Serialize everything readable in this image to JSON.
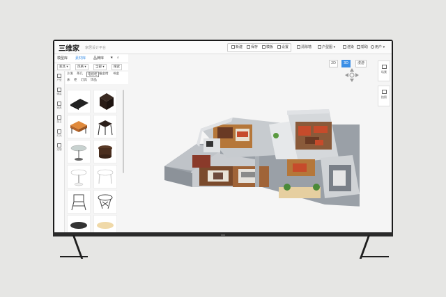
{
  "app": {
    "logo_text": "三维家",
    "subtitle": "家居设计平台"
  },
  "toolbar": {
    "buttons": [
      {
        "label": "新建",
        "icon": "file-icon"
      },
      {
        "label": "保存",
        "icon": "save-icon"
      },
      {
        "label": "模板",
        "icon": "template-icon"
      },
      {
        "label": "设置",
        "icon": "gear-icon"
      },
      {
        "label": "清除墙",
        "icon": "wall-icon"
      },
      {
        "label": "户型图",
        "icon": "floorplan-icon"
      },
      {
        "label": "渲染",
        "icon": "render-icon"
      },
      {
        "label": "帮助",
        "icon": "help-icon"
      },
      {
        "label": "用户",
        "icon": "user-icon"
      }
    ]
  },
  "panel_tabs": [
    {
      "label": "模型库",
      "active": false
    },
    {
      "label": "素材库",
      "active": true
    },
    {
      "label": "品牌库",
      "active": false
    }
  ],
  "filters": {
    "category_select": "家具",
    "style_select": "风格",
    "all_select": "全部",
    "search_placeholder": "搜索"
  },
  "categories": [
    {
      "label": "沙发"
    },
    {
      "label": "茶几"
    },
    {
      "label": "电视柜",
      "boxed": true
    },
    {
      "label": "餐桌椅"
    },
    {
      "label": "书桌"
    },
    {
      "label": "床"
    },
    {
      "label": "柜"
    },
    {
      "label": "灯具"
    },
    {
      "label": "饰品"
    }
  ],
  "side_nav": [
    {
      "label": "户型",
      "icon": "floorplan-icon"
    },
    {
      "label": "硬装",
      "icon": "wall-icon"
    },
    {
      "label": "家具",
      "icon": "furniture-icon"
    },
    {
      "label": "厨卫",
      "icon": "kitchen-icon"
    },
    {
      "label": "灯光",
      "icon": "light-icon"
    },
    {
      "label": "定制",
      "icon": "grid-icon"
    }
  ],
  "view_toggles": [
    {
      "label": "2D",
      "active": false
    },
    {
      "label": "3D",
      "active": true
    },
    {
      "label": "漫游",
      "active": false
    }
  ],
  "right_panel": [
    {
      "label": "场景",
      "icon": "home-icon"
    },
    {
      "label": "拍照",
      "icon": "camera-icon"
    }
  ],
  "colors": {
    "accent": "#3a8ee6",
    "wall": "#c9ccd0",
    "floor_wood": "#b5773a",
    "sofa": "#c64b2b"
  }
}
